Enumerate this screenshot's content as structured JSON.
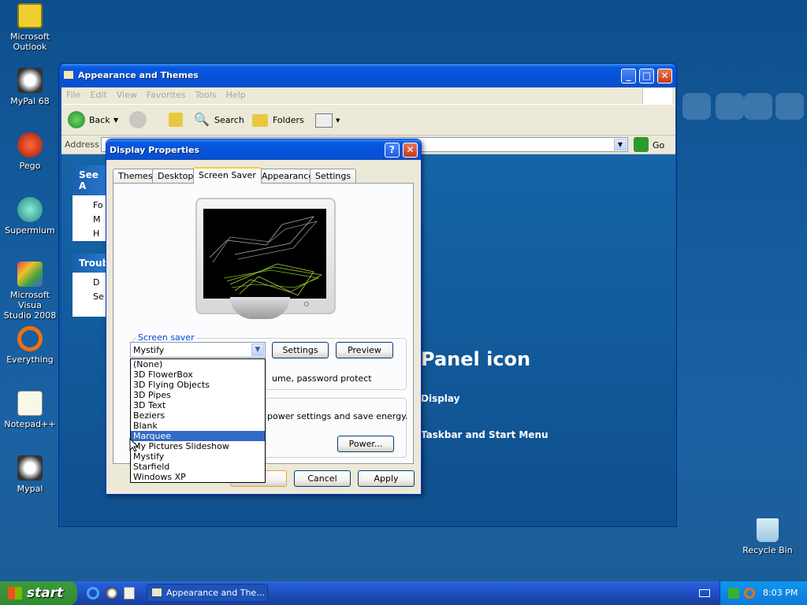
{
  "desktop_icons": [
    {
      "label1": "Microsoft",
      "label2": "Outlook"
    },
    {
      "label1": "MyPal 68",
      "label2": ""
    },
    {
      "label1": "Pego",
      "label2": ""
    },
    {
      "label1": "Supermium",
      "label2": ""
    },
    {
      "label1": "Microsoft Visua",
      "label2": "Studio 2008"
    },
    {
      "label1": "Everything",
      "label2": ""
    },
    {
      "label1": "Notepad++",
      "label2": ""
    },
    {
      "label1": "Mypal",
      "label2": ""
    }
  ],
  "recycle_bin": "Recycle Bin",
  "explorer": {
    "title": "Appearance and Themes",
    "menu": [
      "File",
      "Edit",
      "View",
      "Favorites",
      "Tools",
      "Help"
    ],
    "toolbar": {
      "back": "Back",
      "search": "Search",
      "folders": "Folders"
    },
    "address_label": "Address",
    "go": "Go",
    "see_also": "See A",
    "see_also_items": [
      "Fo",
      "M",
      "H"
    ],
    "trouble": "Troub",
    "trouble_items": [
      "D",
      "Se"
    ],
    "panel_icon_text": "Panel icon",
    "link_display": "Display",
    "link_taskbar": "Taskbar and Start Menu"
  },
  "dialog": {
    "title": "Display Properties",
    "help_glyph": "?",
    "tabs": [
      "Themes",
      "Desktop",
      "Screen Saver",
      "Appearance",
      "Settings"
    ],
    "selected_tab": "Screen Saver",
    "group_label": "Screen saver",
    "combo_value": "Mystify",
    "settings": "Settings",
    "preview": "Preview",
    "partial_text": "ume, password protect",
    "power_text": "power settings and save energy.",
    "power_button": "Power...",
    "ok": "",
    "cancel": "Cancel",
    "apply": "Apply",
    "options": [
      "(None)",
      "3D FlowerBox",
      "3D Flying Objects",
      "3D Pipes",
      "3D Text",
      "Beziers",
      "Blank",
      "Marquee",
      "My Pictures Slideshow",
      "Mystify",
      "Starfield",
      "Windows XP"
    ],
    "highlighted": "Marquee"
  },
  "taskbar": {
    "start": "start",
    "task_title": "Appearance and The...",
    "clock": "8:03 PM"
  }
}
